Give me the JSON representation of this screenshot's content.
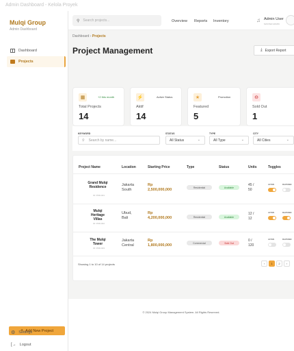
{
  "window": {
    "title": "Admin Dashboard - Kelola Proyek"
  },
  "sidebar": {
    "brand": "Mulqi Group",
    "subtitle": "Admin Dashboard",
    "items": [
      {
        "label": "Dashboard",
        "icon": "dashboard-icon",
        "active": false
      },
      {
        "label": "Projects",
        "icon": "building-icon",
        "active": true
      }
    ],
    "add_button": "Add New Project",
    "settings": "Settings",
    "logout": "Logout"
  },
  "topbar": {
    "search_placeholder": "Search projects...",
    "nav": [
      "Overview",
      "Reports",
      "Inventory"
    ],
    "user_name": "Admin User",
    "user_role": "MASTER ADMIN"
  },
  "breadcrumb": {
    "root": "Dashboard",
    "current": "Projects"
  },
  "page": {
    "title": "Project Management",
    "export_label": "Export Report"
  },
  "stats": [
    {
      "tag": "+2 this month",
      "label": "Total Projects",
      "value": "14",
      "icon": "building-icon"
    },
    {
      "tag": "Active Status",
      "label": "Aktif",
      "value": "14",
      "icon": "bolt-icon"
    },
    {
      "tag": "Promotion",
      "label": "Featured",
      "value": "5",
      "icon": "star-icon"
    },
    {
      "tag": "",
      "label": "Sold Out",
      "value": "1",
      "icon": "minus-circle-icon"
    }
  ],
  "filters": {
    "keyword_label": "KEYWORD",
    "keyword_placeholder": "Search by name...",
    "status_label": "STATUS",
    "status_value": "All Status",
    "type_label": "TYPE",
    "type_value": "All Type",
    "city_label": "CITY",
    "city_value": "All Cities"
  },
  "table": {
    "headers": [
      "Project Name",
      "Location",
      "Starting Price",
      "Type",
      "Status",
      "Units",
      "Toggles"
    ],
    "toggle_labels": [
      "ACTIVE",
      "FEATURED"
    ],
    "rows": [
      {
        "name": "Grand Mulqi Residence",
        "id": "ID: PRD-001",
        "loc1": "Jakarta",
        "loc2": "South",
        "price1": "Rp",
        "price2": "2,500,000,000",
        "type": "Residential",
        "status": "Available",
        "units1": "45 /",
        "units2": "50",
        "active": true,
        "featured": false
      },
      {
        "name": "Mulqi Heritage Villas",
        "id": "ID: PRD-002",
        "loc1": "Ubud,",
        "loc2": "Bali",
        "price1": "Rp",
        "price2": "4,200,000,000",
        "type": "Residential",
        "status": "Available",
        "units1": "12 /",
        "units2": "12",
        "active": true,
        "featured": true
      },
      {
        "name": "The Mulqi Tower",
        "id": "ID: PRD-003",
        "loc1": "Jakarta",
        "loc2": "Central",
        "price1": "Rp",
        "price2": "1,800,000,000",
        "type": "Commercial",
        "status": "Sold Out",
        "units1": "0 /",
        "units2": "120",
        "active": false,
        "featured": false
      }
    ],
    "showing": "Showing 1 to 10 of 14 projects",
    "pages": [
      "1",
      "2"
    ]
  },
  "footer": {
    "text": "© 2024 Mulqi Group Management System. All Rights Reserved."
  },
  "colors": {
    "accent": "#f0a63b",
    "brand": "#b0781c",
    "available_bg": "#d9f5dd",
    "available_fg": "#2e8b3a",
    "soldout_bg": "#fbd9d9",
    "soldout_fg": "#c62828"
  }
}
